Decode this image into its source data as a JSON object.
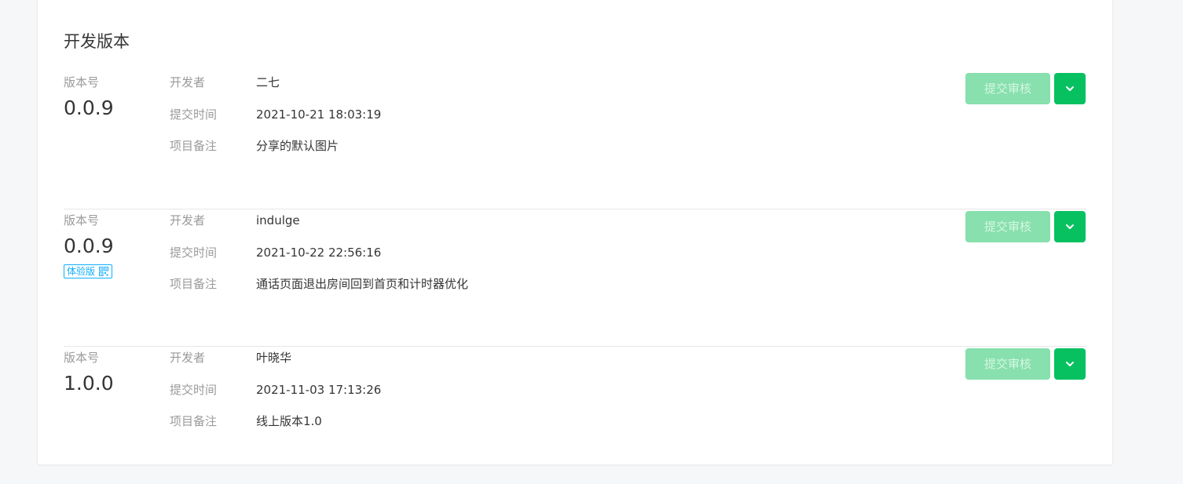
{
  "section": {
    "title": "开发版本"
  },
  "labels": {
    "version": "版本号",
    "developer": "开发者",
    "submit_time": "提交时间",
    "remark": "项目备注",
    "submit_review": "提交审核",
    "trial": "体验版"
  },
  "versions": [
    {
      "version": "0.0.9",
      "developer": "二七",
      "submit_time": "2021-10-21 18:03:19",
      "remark": "分享的默认图片",
      "is_trial": false
    },
    {
      "version": "0.0.9",
      "developer": "indulge",
      "submit_time": "2021-10-22 22:56:16",
      "remark": "通话页面退出房间回到首页和计时器优化",
      "is_trial": true
    },
    {
      "version": "1.0.0",
      "developer": "叶晓华",
      "submit_time": "2021-11-03 17:13:26",
      "remark": "线上版本1.0",
      "is_trial": false
    }
  ],
  "colors": {
    "primary_green": "#07c160",
    "disabled_green": "#87e0ad",
    "trial_blue": "#10aeff",
    "label_gray": "#9a9a9a",
    "text": "#353535",
    "page_bg": "#f6f7f9"
  },
  "icons": {
    "dropdown": "chevron-down-icon",
    "trial_qr": "qrcode-icon"
  }
}
